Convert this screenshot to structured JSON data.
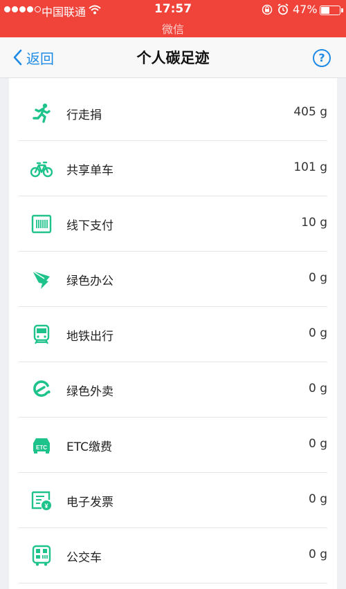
{
  "status_bar": {
    "carrier": "中国联通",
    "time": "17:57",
    "battery": "47%",
    "battery_level": 0.47,
    "app_source": "微信"
  },
  "nav": {
    "back_label": "返回",
    "title": "个人碳足迹",
    "help_label": "?"
  },
  "colors": {
    "status_bar": "#f0433a",
    "accent_blue": "#1d8ae6",
    "icon_green": "#1ec28b"
  },
  "items": [
    {
      "label": "行走捐",
      "value": "405 g",
      "icon": "running-icon"
    },
    {
      "label": "共享单车",
      "value": "101 g",
      "icon": "bicycle-icon"
    },
    {
      "label": "线下支付",
      "value": "10 g",
      "icon": "barcode-scanner-icon"
    },
    {
      "label": "绿色办公",
      "value": "0 g",
      "icon": "dingtalk-icon"
    },
    {
      "label": "地铁出行",
      "value": "0 g",
      "icon": "subway-icon"
    },
    {
      "label": "绿色外卖",
      "value": "0 g",
      "icon": "eleme-icon"
    },
    {
      "label": "ETC缴费",
      "value": "0 g",
      "icon": "etc-car-icon",
      "icon_text": "ETC"
    },
    {
      "label": "电子发票",
      "value": "0 g",
      "icon": "e-invoice-icon",
      "icon_text": "¥"
    },
    {
      "label": "公交车",
      "value": "0 g",
      "icon": "bus-qr-icon"
    }
  ]
}
